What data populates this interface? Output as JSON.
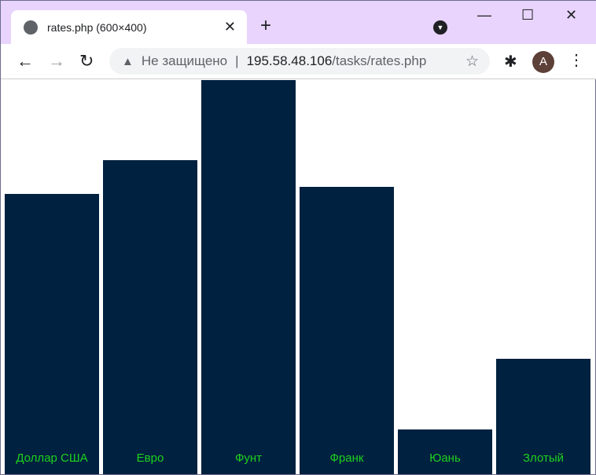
{
  "tab": {
    "title": "rates.php (600×400)",
    "icon": "globe-icon"
  },
  "omnibox": {
    "security": "Не защищено",
    "separator": "|",
    "host": "195.58.48.106",
    "path": "/tasks/rates.php"
  },
  "profile": {
    "initial": "A",
    "color": "#5d4037"
  },
  "colors": {
    "bar": "#00213f",
    "label": "#1ed11e",
    "titlebar": "#e8d4fc"
  },
  "chart_data": {
    "type": "bar",
    "categories": [
      "Доллар США",
      "Евро",
      "Фунт",
      "Франк",
      "Юань",
      "Злотый"
    ],
    "values": [
      286,
      320,
      402,
      293,
      46,
      118
    ],
    "ylim": [
      0,
      402
    ],
    "grid": false
  }
}
